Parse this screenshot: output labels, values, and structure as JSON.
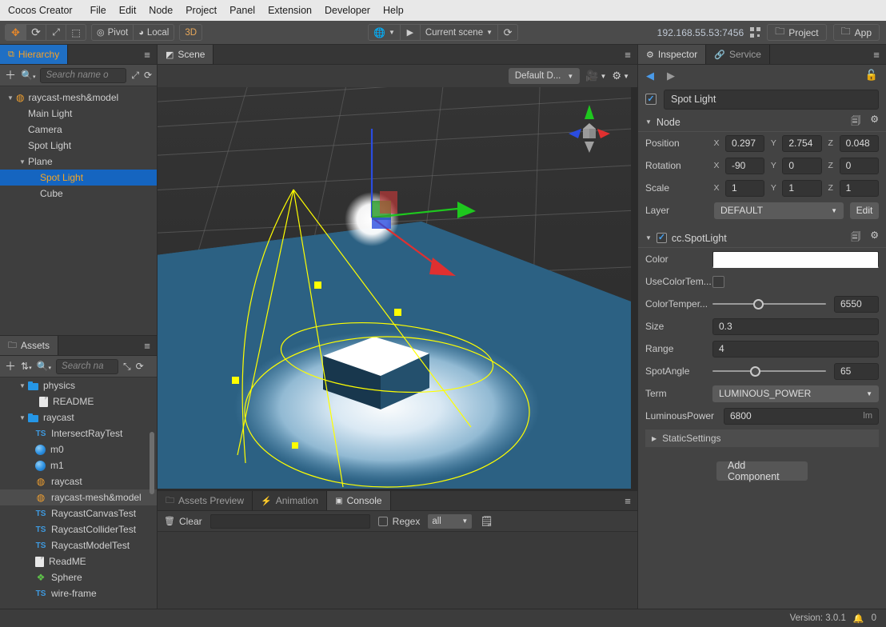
{
  "menubar": {
    "items": [
      {
        "label": "Cocos Creator"
      },
      {
        "label": "File"
      },
      {
        "label": "Edit"
      },
      {
        "label": "Node"
      },
      {
        "label": "Project"
      },
      {
        "label": "Panel"
      },
      {
        "label": "Extension"
      },
      {
        "label": "Developer"
      },
      {
        "label": "Help"
      }
    ]
  },
  "toolbar": {
    "transform_tools": [
      {
        "name": "move-tool",
        "glyph": "✥",
        "active": true
      },
      {
        "name": "rotate-tool",
        "glyph": "⟳",
        "active": false
      },
      {
        "name": "scale-tool",
        "glyph": "⤢",
        "active": false
      },
      {
        "name": "rect-tool",
        "glyph": "⬚",
        "active": false
      }
    ],
    "pivot_label": "Pivot",
    "coord_label": "Local",
    "dimension_label": "3D",
    "preview_device_label": "",
    "play_label": "",
    "scene_selector_label": "Current scene",
    "refresh_label": "",
    "address": "192.168.55.53:7456",
    "project_button": "Project",
    "app_button": "App"
  },
  "hierarchy": {
    "tab_label": "Hierarchy",
    "search_placeholder": "Search name o",
    "nodes": [
      {
        "label": "raycast-mesh&model",
        "depth": 0,
        "icon": "scene-flame-icon",
        "expanded": true,
        "selected": false
      },
      {
        "label": "Main Light",
        "depth": 1,
        "icon": "none",
        "expanded": null,
        "selected": false
      },
      {
        "label": "Camera",
        "depth": 1,
        "icon": "none",
        "expanded": null,
        "selected": false
      },
      {
        "label": "Spot Light",
        "depth": 1,
        "icon": "none",
        "expanded": null,
        "selected": false
      },
      {
        "label": "Plane",
        "depth": 1,
        "icon": "none",
        "expanded": true,
        "selected": false
      },
      {
        "label": "Spot Light",
        "depth": 2,
        "icon": "none",
        "expanded": null,
        "selected": true
      },
      {
        "label": "Cube",
        "depth": 2,
        "icon": "none",
        "expanded": null,
        "selected": false
      }
    ]
  },
  "assets": {
    "tab_label": "Assets",
    "search_placeholder": "Search na",
    "items": [
      {
        "label": "physics",
        "depth": 1,
        "icon": "folder-icon",
        "expanded": true,
        "highlighted": false
      },
      {
        "label": "README",
        "depth": 2,
        "icon": "document-icon",
        "expanded": null,
        "highlighted": false
      },
      {
        "label": "raycast",
        "depth": 1,
        "icon": "folder-icon",
        "expanded": true,
        "highlighted": false
      },
      {
        "label": "IntersectRayTest",
        "depth": 2,
        "icon": "typescript-icon",
        "expanded": null,
        "highlighted": false
      },
      {
        "label": "m0",
        "depth": 2,
        "icon": "material-icon",
        "expanded": null,
        "highlighted": false
      },
      {
        "label": "m1",
        "depth": 2,
        "icon": "material-icon",
        "expanded": null,
        "highlighted": false
      },
      {
        "label": "raycast",
        "depth": 2,
        "icon": "scene-flame-icon",
        "expanded": null,
        "highlighted": false
      },
      {
        "label": "raycast-mesh&model",
        "depth": 2,
        "icon": "scene-flame-icon",
        "expanded": null,
        "highlighted": true
      },
      {
        "label": "RaycastCanvasTest",
        "depth": 2,
        "icon": "typescript-icon",
        "expanded": null,
        "highlighted": false
      },
      {
        "label": "RaycastColliderTest",
        "depth": 2,
        "icon": "typescript-icon",
        "expanded": null,
        "highlighted": false
      },
      {
        "label": "RaycastModelTest",
        "depth": 2,
        "icon": "typescript-icon",
        "expanded": null,
        "highlighted": false
      },
      {
        "label": "ReadME",
        "depth": 2,
        "icon": "document-icon",
        "expanded": null,
        "highlighted": false
      },
      {
        "label": "Sphere",
        "depth": 2,
        "icon": "mesh-icon",
        "expanded": null,
        "highlighted": false
      },
      {
        "label": "wire-frame",
        "depth": 2,
        "icon": "typescript-icon",
        "expanded": null,
        "highlighted": false
      }
    ]
  },
  "scene": {
    "tab_label": "Scene",
    "renderer_label": "Default D...",
    "camera_tool_label": "",
    "gear_label": ""
  },
  "console": {
    "tabs": [
      {
        "label": "Assets Preview",
        "active": false
      },
      {
        "label": "Animation",
        "active": false
      },
      {
        "label": "Console",
        "active": true
      }
    ],
    "clear_label": "Clear",
    "filter_value": "",
    "regex_label": "Regex",
    "level_label": "all"
  },
  "inspector": {
    "tabs": [
      {
        "label": "Inspector",
        "active": true
      },
      {
        "label": "Service",
        "active": false
      }
    ],
    "node_name": "Spot Light",
    "node_enabled": true,
    "node_section": {
      "title": "Node",
      "position": {
        "label": "Position",
        "x": "0.297",
        "y": "2.754",
        "z": "0.048"
      },
      "rotation": {
        "label": "Rotation",
        "x": "-90",
        "y": "0",
        "z": "0"
      },
      "scale": {
        "label": "Scale",
        "x": "1",
        "y": "1",
        "z": "1"
      },
      "layer": {
        "label": "Layer",
        "value": "DEFAULT",
        "edit_label": "Edit"
      }
    },
    "component": {
      "title": "cc.SpotLight",
      "enabled": true,
      "color": {
        "label": "Color",
        "value": "#FFFFFF"
      },
      "use_color_temperature": {
        "label": "UseColorTem...",
        "checked": false
      },
      "color_temperature": {
        "label": "ColorTemper...",
        "value": "6550",
        "slider_pct": 38
      },
      "size": {
        "label": "Size",
        "value": "0.3"
      },
      "range": {
        "label": "Range",
        "value": "4"
      },
      "spot_angle": {
        "label": "SpotAngle",
        "value": "65",
        "slider_pct": 39
      },
      "term": {
        "label": "Term",
        "value": "LUMINOUS_POWER"
      },
      "luminous_power": {
        "label": "LuminousPower",
        "value": "6800",
        "unit": "lm"
      },
      "static_settings": {
        "label": "StaticSettings"
      }
    },
    "add_component_label": "Add Component"
  },
  "statusbar": {
    "version_label": "Version: 3.0.1",
    "notification_count": "0"
  },
  "colors": {
    "accent_blue": "#1565c0",
    "accent_orange": "#f6a623",
    "panel_bg": "#434343",
    "tree_bg": "#3e3e3e",
    "gizmo_yellow": "#ffff00",
    "plane_blue": "#2b5f80",
    "axis_x": "#e03030",
    "axis_y": "#1ec81e",
    "axis_z": "#2a4ce0"
  }
}
